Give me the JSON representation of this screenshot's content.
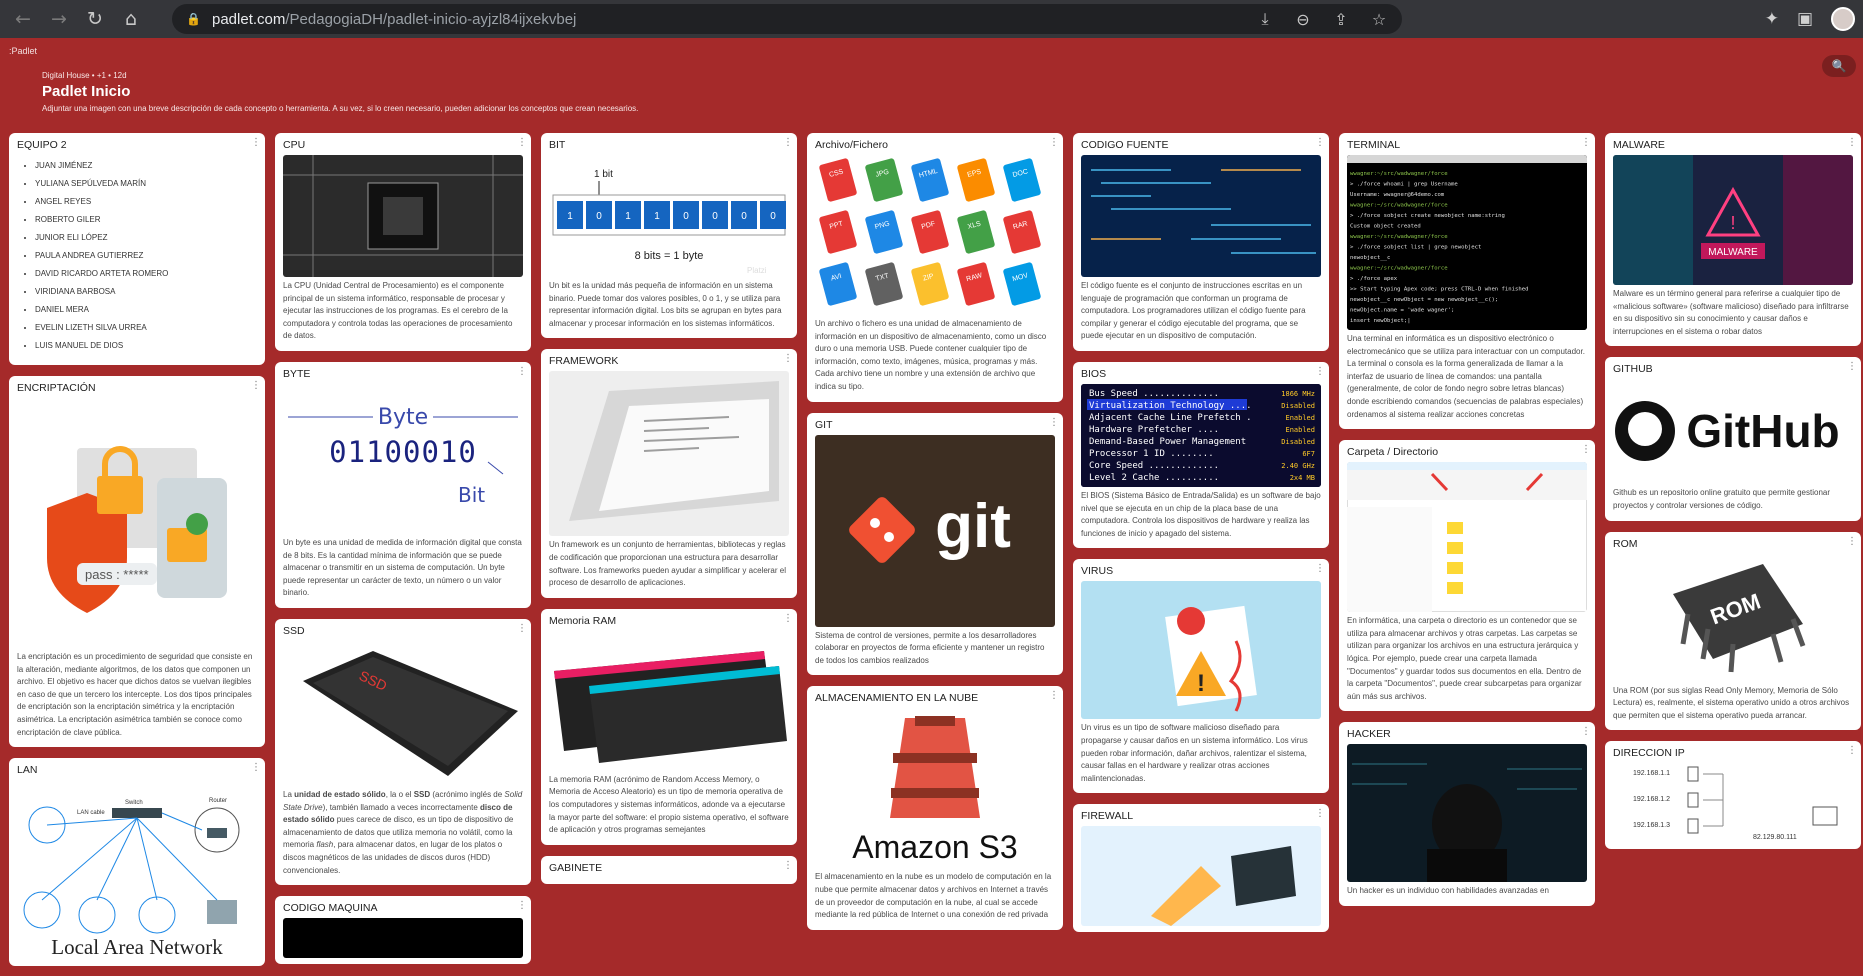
{
  "browser": {
    "url_domain": "padlet.com",
    "url_path": "/PedagogiaDH/padlet-inicio-ayjzl84ijxekvbej"
  },
  "header": {
    "logo": ":Padlet",
    "author_line": "Digital House • +1 • 12d",
    "title": "Padlet Inicio",
    "description": "Adjuntar una imagen con una breve descripción de cada concepto o herramienta. A su vez, si lo creen necesario, pueden adicionar los conceptos que crean necesarios."
  },
  "cards": {
    "equipo": {
      "title": "EQUIPO 2",
      "members": [
        "JUAN JIMÉNEZ",
        "YULIANA SEPÚLVEDA MARÍN",
        "ANGEL REYES",
        "ROBERTO GILER",
        "JUNIOR ELI LÓPEZ",
        "PAULA ANDREA GUTIERREZ",
        "DAVID RICARDO ARTETA ROMERO",
        "VIRIDIANA BARBOSA",
        "DANIEL MERA",
        "EVELIN LIZETH SILVA URREA",
        "LUIS MANUEL DE DIOS"
      ]
    },
    "encriptacion": {
      "title": "ENCRIPTACIÓN",
      "img_text": "pass : *****",
      "body": "La encriptación es un procedimiento de seguridad que consiste en la alteración, mediante algoritmos, de los datos que componen un archivo. El objetivo es hacer que dichos datos se vuelvan ilegibles en caso de que un tercero los intercepte. Los dos tipos principales de encriptación son la encriptación simétrica y la encriptación asimétrica. La encriptación asimétrica también se conoce como encriptación de clave pública."
    },
    "lan": {
      "title": "LAN",
      "img_caption": "Local Area Network",
      "labels": {
        "switch": "Switch",
        "router": "Router",
        "cable": "LAN cable"
      }
    },
    "cpu": {
      "title": "CPU",
      "body": "La CPU (Unidad Central de Procesamiento) es el componente principal de un sistema informático, responsable de procesar y ejecutar las instrucciones de los programas. Es el cerebro de la computadora y controla todas las operaciones de procesamiento de datos."
    },
    "byte": {
      "title": "BYTE",
      "img_byte": "Byte",
      "img_bit": "Bit",
      "img_bits": "01100010",
      "body": "Un byte es una unidad de medida de información digital que consta de 8 bits. Es la cantidad mínima de información que se puede almacenar o transmitir en un sistema de computación. Un byte puede representar un carácter de texto, un número o un valor binario."
    },
    "ssd": {
      "title": "SSD",
      "img_label": "SSD",
      "body_html_parts": [
        "La ",
        "unidad de estado sólido",
        ", la o el ",
        "SSD",
        " (acrónimo inglés de ",
        "Solid State Drive",
        "), también llamado a veces incorrectamente ",
        "disco de estado sólido",
        " pues carece de disco, es un tipo de dispositivo de almacenamiento de datos que utiliza memoria no volátil, como la memoria ",
        "flash",
        ", para almacenar datos, en lugar de los platos o discos magnéticos de las unidades de discos duros (HDD) convencionales."
      ]
    },
    "codigo_maquina": {
      "title": "CODIGO MAQUINA"
    },
    "bit": {
      "title": "BIT",
      "img_label": "1 bit",
      "img_bits": [
        "1",
        "0",
        "1",
        "1",
        "0",
        "0",
        "0",
        "0"
      ],
      "img_caption": "8 bits = 1 byte",
      "img_watermark": "Platzi",
      "body": "Un bit es la unidad más pequeña de información en un sistema binario. Puede tomar dos valores posibles, 0 o 1, y se utiliza para representar información digital. Los bits se agrupan en bytes para almacenar y procesar información en los sistemas informáticos."
    },
    "framework": {
      "title": "FRAMEWORK",
      "body": "Un framework es un conjunto de herramientas, bibliotecas y reglas de codificación que proporcionan una estructura para desarrollar software. Los frameworks pueden ayudar a simplificar y acelerar el proceso de desarrollo de aplicaciones."
    },
    "memoria_ram": {
      "title": "Memoria RAM",
      "body": "La memoria RAM (acrónimo de Random Access Memory, o Memoria de Acceso Aleatorio) es un tipo de memoria operativa de los computadores y sistemas informáticos, adonde va a ejecutarse la mayor parte del software: el propio sistema operativo, el software de aplicación y otros programas semejantes"
    },
    "gabinete": {
      "title": "GABINETE"
    },
    "archivo": {
      "title": "Archivo/Fichero",
      "file_types": [
        "CSS",
        "JPG",
        "HTML",
        "EPS",
        "DOC",
        "PPT",
        "PNG",
        "PDF",
        "XLS",
        "RAR",
        "AVI",
        "TXT",
        "ZIP",
        "RAW",
        "MOV"
      ],
      "body": "Un archivo o fichero es una unidad de almacenamiento de información en un dispositivo de almacenamiento, como un disco duro o una memoria USB. Puede contener cualquier tipo de información, como texto, imágenes, música, programas y más. Cada archivo tiene un nombre y una extensión de archivo que indica su tipo."
    },
    "git": {
      "title": "GIT",
      "img_text": "git",
      "body": "Sistema de control de versiones, permite a los desarrolladores colaborar en proyectos de forma eficiente y mantener un registro de todos los cambios realizados"
    },
    "nube": {
      "title": "ALMACENAMIENTO EN LA NUBE",
      "img_text": "Amazon S3",
      "body": "El almacenamiento en la nube es un modelo de computación en la nube que permite almacenar datos y archivos en Internet a través de un proveedor de computación en la nube, al cual se accede mediante la red pública de Internet o una conexión de red privada"
    },
    "codigo_fuente": {
      "title": "CODIGO FUENTE",
      "body": "El código fuente es el conjunto de instrucciones escritas en un lenguaje de programación que conforman un programa de computadora. Los programadores utilizan el código fuente para compilar y generar el código ejecutable del programa, que se puede ejecutar en un dispositivo de computación."
    },
    "bios": {
      "title": "BIOS",
      "img_lines": [
        {
          "label": "Bus Speed ..............",
          "value": "1866 MHz"
        },
        {
          "label": "Virtualization Technology ....",
          "value": "Disabled"
        },
        {
          "label": "Adjacent Cache Line Prefetch .",
          "value": "Enabled"
        },
        {
          "label": "Hardware Prefetcher ....",
          "value": "Enabled"
        },
        {
          "label": "Demand-Based Power Management",
          "value": "Disabled"
        },
        {
          "label": "Processor 1 ID ........",
          "value": "6F7"
        },
        {
          "label": "Core Speed .............",
          "value": "2.40 GHz"
        },
        {
          "label": "Level 2 Cache ..........",
          "value": "2x4 MB"
        }
      ],
      "body": "El BIOS (Sistema Básico de Entrada/Salida) es un software de bajo nivel que se ejecuta en un chip de la placa base de una computadora. Controla los dispositivos de hardware y realiza las funciones de inicio y apagado del sistema."
    },
    "virus": {
      "title": "VIRUS",
      "body": "Un virus es un tipo de software malicioso diseñado para propagarse y causar daños en un sistema informático. Los virus pueden robar información, dañar archivos, ralentizar el sistema, causar fallas en el hardware y realizar otras acciones malintencionadas."
    },
    "firewall": {
      "title": "FIREWALL"
    },
    "terminal": {
      "title": "TERMINAL",
      "img_lines": [
        "wwagner:~/src/wadwagner/force",
        "> ./force whoami | grep Username",
        "Username: wwagner@64demo.com",
        "wwagner:~/src/wadwagner/force",
        "> ./force sobject create newobject name:string",
        "Custom object created",
        "wwagner:~/src/wadwagner/force",
        "> ./force sobject list | grep newobject",
        "newobject__c",
        "wwagner:~/src/wadwagner/force",
        "> ./force apex",
        ">> Start typing Apex code; press CTRL-D when finished",
        "newobject__c newObject = new newobject__c();",
        "newObject.name = 'wade wagner';",
        "insert newObject;|"
      ],
      "body": "Una terminal en informática es un dispositivo electrónico o electromecánico que se utiliza para interactuar con un computador. La terminal o consola es la forma generalizada de llamar a la interfaz de usuario de línea de comandos: una pantalla (generalmente, de color de fondo negro sobre letras blancas) donde escribiendo comandos (secuencias de palabras especiales) ordenamos al sistema realizar acciones concretas"
    },
    "carpeta": {
      "title": "Carpeta / Directorio",
      "body": "En informática, una carpeta o directorio es un contenedor que se utiliza para almacenar archivos y otras carpetas. Las carpetas se utilizan para organizar los archivos en una estructura jerárquica y lógica. Por ejemplo, puede crear una carpeta llamada \"Documentos\" y guardar todos sus documentos en ella. Dentro de la carpeta \"Documentos\", puede crear subcarpetas para organizar aún más sus archivos."
    },
    "hacker": {
      "title": "HACKER",
      "body": "Un hacker es un individuo con habilidades avanzadas en"
    },
    "malware": {
      "title": "MALWARE",
      "img_text": "MALWARE",
      "body": "Malware es un término general para referirse a cualquier tipo de «malicious software» (software malicioso) diseñado para infiltrarse en su dispositivo sin su conocimiento y causar daños e interrupciones en el sistema o robar datos"
    },
    "github": {
      "title": "GITHUB",
      "img_text": "GitHub",
      "body": "Github es un repositorio online gratuito que permite gestionar proyectos y controlar versiones de código."
    },
    "rom": {
      "title": "ROM",
      "img_text": "ROM",
      "body": "Una ROM (por sus siglas Read Only Memory, Memoria de Sólo Lectura) es, realmente, el sistema operativo unido a otros archivos que permiten que el sistema operativo pueda arrancar."
    },
    "ip": {
      "title": "DIRECCION IP",
      "img_ips": [
        "192.168.1.1",
        "192.168.1.2",
        "192.168.1.3",
        "82.129.80.111"
      ]
    }
  }
}
